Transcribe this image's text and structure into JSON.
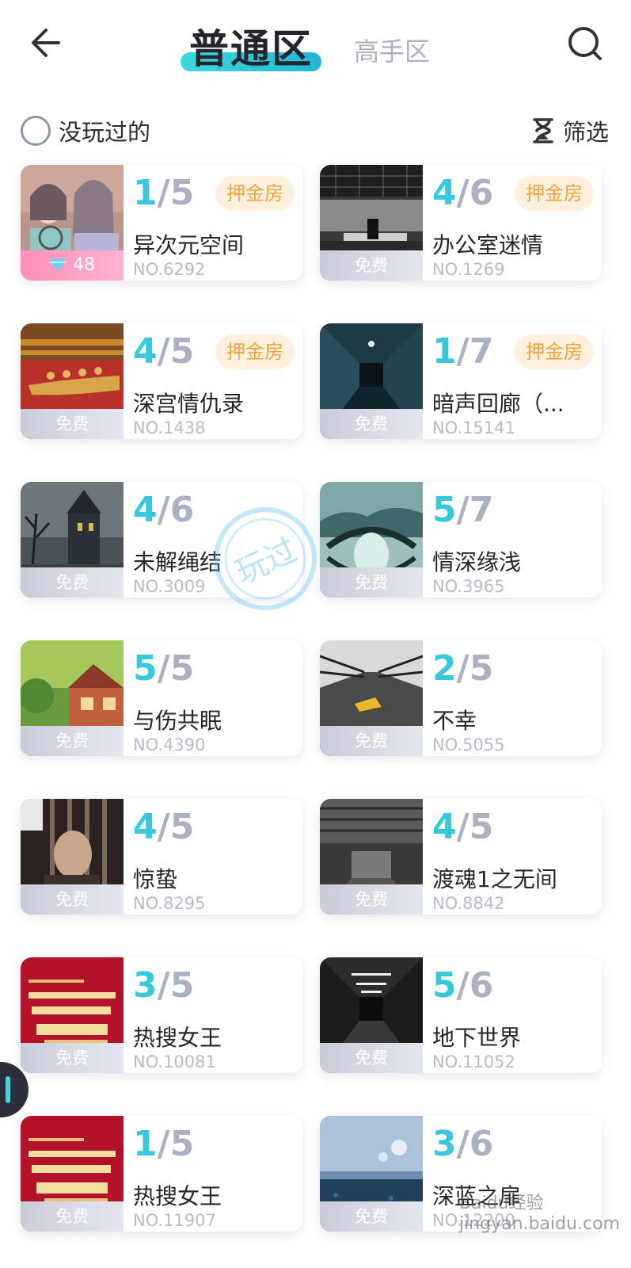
{
  "header": {
    "tabs": [
      {
        "label": "普通区",
        "active": true
      },
      {
        "label": "高手区",
        "active": false
      }
    ]
  },
  "filters": {
    "unplayed_label": "没玩过的",
    "filter_label": "筛选"
  },
  "rooms": [
    {
      "current": "1",
      "total": "/5",
      "name": "异次元空间",
      "no": "NO.6292",
      "price": "48",
      "price_type": "gem",
      "badge": "押金房"
    },
    {
      "current": "4",
      "total": "/6",
      "name": "办公室迷情",
      "no": "NO.1269",
      "price": "免费",
      "price_type": "free",
      "badge": "押金房"
    },
    {
      "current": "4",
      "total": "/5",
      "name": "深宫情仇录",
      "no": "NO.1438",
      "price": "免费",
      "price_type": "free",
      "badge": "押金房"
    },
    {
      "current": "1",
      "total": "/7",
      "name": "暗声回廊（...",
      "no": "NO.15141",
      "price": "免费",
      "price_type": "free",
      "badge": "押金房"
    },
    {
      "current": "4",
      "total": "/6",
      "name": "未解绳结",
      "no": "NO.3009",
      "price": "免费",
      "price_type": "free",
      "badge": ""
    },
    {
      "current": "5",
      "total": "/7",
      "name": "情深缘浅",
      "no": "NO.3965",
      "price": "免费",
      "price_type": "free",
      "badge": ""
    },
    {
      "current": "5",
      "total": "/5",
      "name": "与伤共眠",
      "no": "NO.4390",
      "price": "免费",
      "price_type": "free",
      "badge": ""
    },
    {
      "current": "2",
      "total": "/5",
      "name": "不幸",
      "no": "NO.5055",
      "price": "免费",
      "price_type": "free",
      "badge": ""
    },
    {
      "current": "4",
      "total": "/5",
      "name": "惊蛰",
      "no": "NO.8295",
      "price": "免费",
      "price_type": "free",
      "badge": ""
    },
    {
      "current": "4",
      "total": "/5",
      "name": "渡魂1之无间",
      "no": "NO.8842",
      "price": "免费",
      "price_type": "free",
      "badge": ""
    },
    {
      "current": "3",
      "total": "/5",
      "name": "热搜女王",
      "no": "NO.10081",
      "price": "免费",
      "price_type": "free",
      "badge": ""
    },
    {
      "current": "5",
      "total": "/6",
      "name": "地下世界",
      "no": "NO.11052",
      "price": "免费",
      "price_type": "free",
      "badge": ""
    },
    {
      "current": "1",
      "total": "/5",
      "name": "热搜女王",
      "no": "NO.11907",
      "price": "免费",
      "price_type": "free",
      "badge": ""
    },
    {
      "current": "3",
      "total": "/6",
      "name": "深蓝之扉",
      "no": "NO.12200",
      "price": "免费",
      "price_type": "free",
      "badge": ""
    }
  ],
  "stamp": "玩过",
  "watermark": "Baidu经验 jingyan.baidu.com",
  "colors": {
    "accent": "#36c9dc",
    "badge_text": "#f6a23a",
    "badge_bg": "#fff1de",
    "muted": "#a9b1c3"
  }
}
